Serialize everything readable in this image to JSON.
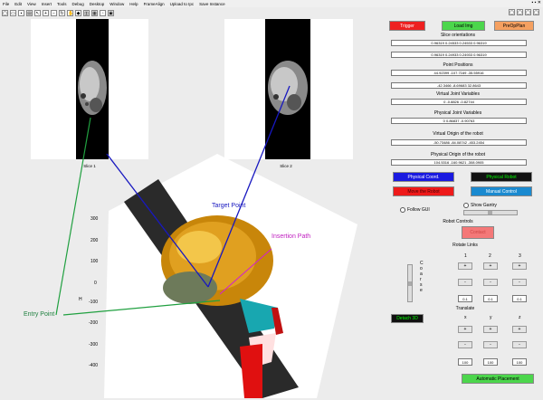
{
  "menu": [
    "File",
    "Edit",
    "View",
    "Insert",
    "Tools",
    "Debug",
    "Desktop",
    "Window",
    "Help",
    "FrameAlign",
    "Upload to Ipc",
    "Save Instance"
  ],
  "window_controls": "▪ ▪ ✕",
  "slices": [
    {
      "label": "Slice 1"
    },
    {
      "label": "Slice 2"
    }
  ],
  "panel": {
    "trigger": "Trigger",
    "load_img": "Load Img",
    "preop": "PreOpPlan",
    "slice_orient_label": "Slice orientations",
    "slice_orient_1": "0.96319   0.24533   0.24533   0.96319",
    "slice_orient_2": "0.96319   0.24933   0.24933   0.96319",
    "point_pos_label": "Point Positions",
    "point_pos_1": "44.92399   -107.7169   -35.55916",
    "point_pos_2": "-42.3466   -8.69683   32.8643",
    "virt_joint_label": "Virtual Joint Variables",
    "virt_joint": "0   -0.8826   -0.82744",
    "phys_joint_label": "Physical Joint Variables",
    "phys_joint": "0   0.86837   -0.90763",
    "virt_origin_label": "Virtual Origin of the robot",
    "virt_origin": "-50.73486   -84.08742   -453.2454",
    "phys_origin_label": "Physical Origin of the robot",
    "phys_origin": "104.5316   -160.9621   -308.0905",
    "physical_coord": "Physical Coord.",
    "physical_robot": "Physical Robot",
    "move_robot": "Move the Robot",
    "manual_control": "Manual Control",
    "follow_gui": "Follow GUI",
    "show_gantry": "Show Gantry",
    "robot_controls": "Robot Controls",
    "contact": "Contact",
    "rotate_links": "Rotate Links",
    "rot_headers": [
      "1",
      "2",
      "3"
    ],
    "rot_vals": [
      "0.1",
      "0.1",
      "0.1"
    ],
    "coarse": "C o a r s e",
    "translate": "Translate",
    "trans_headers": [
      "x",
      "y",
      "z"
    ],
    "trans_vals": [
      "100",
      "100",
      "100"
    ],
    "detach": "Detach 3D",
    "auto_place": "Automatic Placement",
    "plus": "+",
    "minus": "-"
  },
  "annotations": {
    "target": "Target Point",
    "insertion": "Insertion Path",
    "entry": "Entry Point"
  },
  "yaxis": [
    "300",
    "200",
    "100",
    "0",
    "-100",
    "-200",
    "-300",
    "-400"
  ],
  "ylabel": "H"
}
